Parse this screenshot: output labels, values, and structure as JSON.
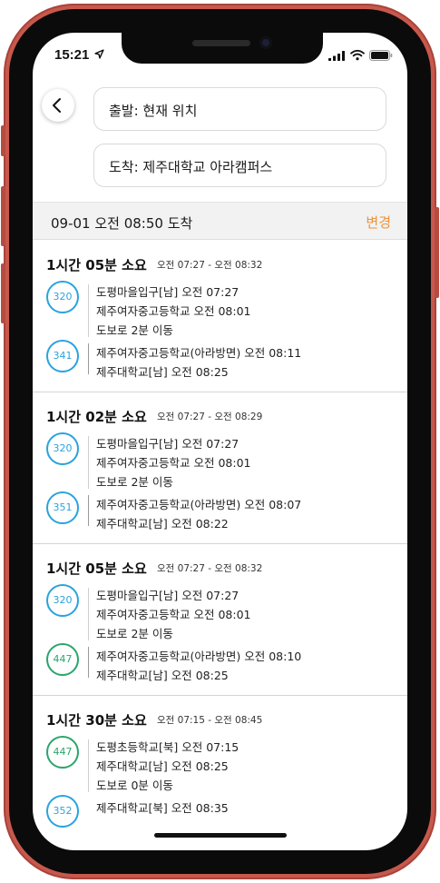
{
  "status_bar": {
    "time": "15:21"
  },
  "search": {
    "origin": "출발: 현재 위치",
    "destination": "도착: 제주대학교 아라캠퍼스"
  },
  "date_bar": {
    "arrival": "09-01 오전 08:50 도착",
    "change_label": "변경"
  },
  "colors": {
    "accent_orange": "#f0923a",
    "bus_blue": "#2aa3dd",
    "bus_green": "#2aa56b"
  },
  "routes": [
    {
      "duration": "1시간 05분 소요",
      "time_range": "오전 07:27 - 오전 08:32",
      "legs": [
        {
          "bus": "320",
          "color": "blue",
          "stops": [
            "도평마을입구[남] 오전 07:27",
            "제주여자중고등학교 오전 08:01"
          ]
        },
        {
          "walk": "도보로 2분 이동"
        },
        {
          "bus": "341",
          "color": "blue",
          "stops": [
            "제주여자중고등학교(아라방면) 오전 08:11",
            "제주대학교[남] 오전 08:25"
          ]
        }
      ]
    },
    {
      "duration": "1시간 02분 소요",
      "time_range": "오전 07:27 - 오전 08:29",
      "legs": [
        {
          "bus": "320",
          "color": "blue",
          "stops": [
            "도평마을입구[남] 오전 07:27",
            "제주여자중고등학교 오전 08:01"
          ]
        },
        {
          "walk": "도보로 2분 이동"
        },
        {
          "bus": "351",
          "color": "blue",
          "stops": [
            "제주여자중고등학교(아라방면) 오전 08:07",
            "제주대학교[남] 오전 08:22"
          ]
        }
      ]
    },
    {
      "duration": "1시간 05분 소요",
      "time_range": "오전 07:27 - 오전 08:32",
      "legs": [
        {
          "bus": "320",
          "color": "blue",
          "stops": [
            "도평마을입구[남] 오전 07:27",
            "제주여자중고등학교 오전 08:01"
          ]
        },
        {
          "walk": "도보로 2분 이동"
        },
        {
          "bus": "447",
          "color": "green",
          "stops": [
            "제주여자중고등학교(아라방면) 오전 08:10",
            "제주대학교[남] 오전 08:25"
          ]
        }
      ]
    },
    {
      "duration": "1시간 30분 소요",
      "time_range": "오전 07:15 - 오전 08:45",
      "legs": [
        {
          "bus": "447",
          "color": "green",
          "stops": [
            "도평초등학교[북] 오전 07:15",
            "제주대학교[남] 오전 08:25"
          ]
        },
        {
          "walk": "도보로 0분 이동"
        },
        {
          "bus": "352",
          "color": "blue",
          "stops": [
            "제주대학교[북] 오전 08:35"
          ]
        }
      ]
    }
  ]
}
